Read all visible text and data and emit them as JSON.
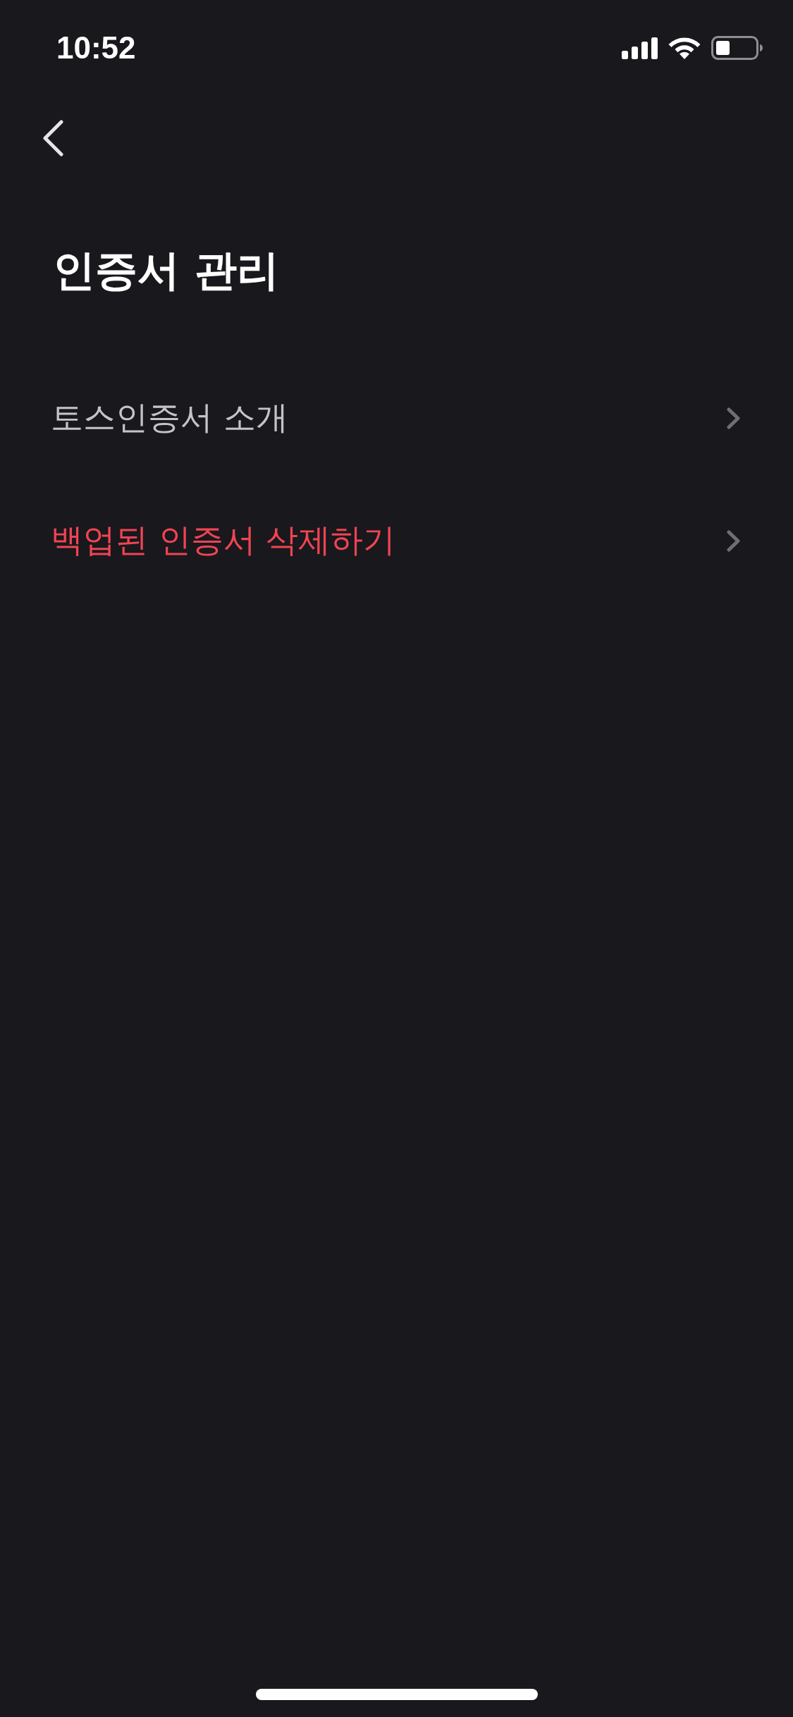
{
  "status_bar": {
    "time": "10:52"
  },
  "title": "인증서 관리",
  "menu_items": [
    {
      "label": "토스인증서 소개",
      "color": "#c3c3c8"
    },
    {
      "label": "백업된 인증서 삭제하기",
      "color": "#f04452"
    }
  ]
}
